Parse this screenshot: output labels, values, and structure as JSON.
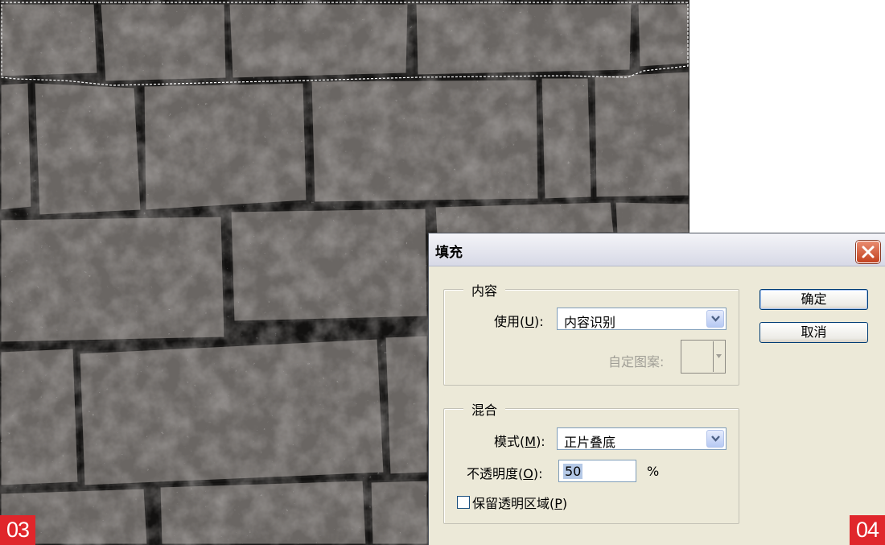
{
  "step_badges": {
    "left": "03",
    "right": "04"
  },
  "dialog": {
    "title": "填充",
    "content_group": {
      "legend": "内容",
      "use_label_prefix": "使用(",
      "use_label_key": "U",
      "use_label_suffix": "):",
      "use_value": "内容识别",
      "custom_pattern_label": "自定图案:"
    },
    "blend_group": {
      "legend": "混合",
      "mode_label_prefix": "模式(",
      "mode_label_key": "M",
      "mode_label_suffix": "):",
      "mode_value": "正片叠底",
      "opacity_label_prefix": "不透明度(",
      "opacity_label_key": "O",
      "opacity_label_suffix": "):",
      "opacity_value": "50",
      "opacity_unit": "%",
      "preserve_label_prefix": "保留透明区域(",
      "preserve_label_key": "P",
      "preserve_label_suffix": ")",
      "preserve_checked": false
    },
    "buttons": {
      "ok": "确定",
      "cancel": "取消"
    }
  },
  "icons": {
    "close": "close-icon",
    "dropdown": "chevron-down-icon",
    "pattern_arrow": "small-down-arrow-icon"
  },
  "colors": {
    "badge": "#e0262b",
    "dialog_bg": "#ece9d8",
    "selection_marquee": "#ffffff"
  }
}
